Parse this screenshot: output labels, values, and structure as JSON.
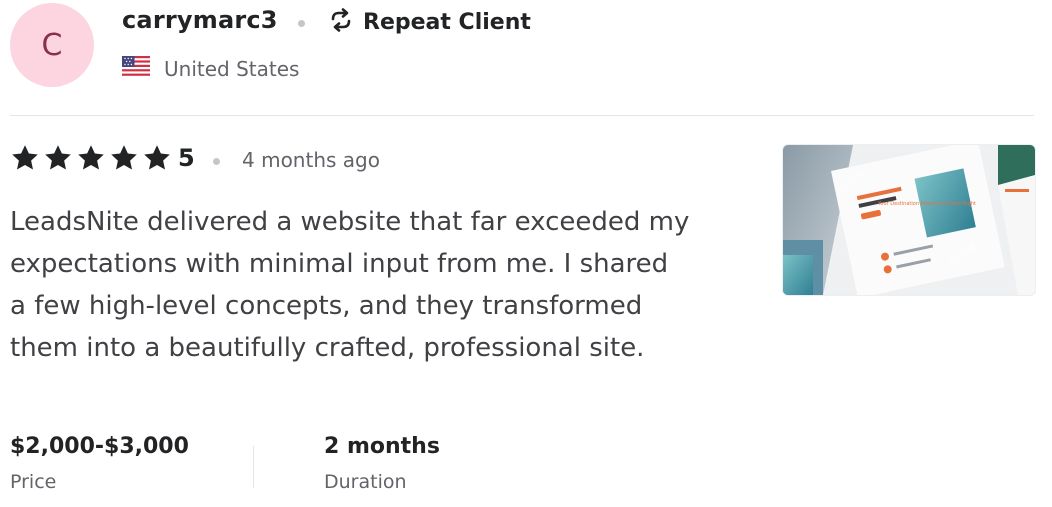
{
  "reviewer": {
    "avatar_initial": "C",
    "username": "carrymarc3",
    "badge": "Repeat Client",
    "badge_icon": "repeat-icon",
    "country": "United States",
    "flag_icon": "us-flag-icon"
  },
  "review": {
    "rating": "5",
    "stars": 5,
    "time_ago": "4 months ago",
    "text": "LeadsNite delivered a website that far exceeded my expectations with minimal input from me. I shared a few high-level concepts, and they transformed them into a beautifully crafted, professional site.",
    "thumbnail_brand": "fiverr.",
    "thumbnail_headline": "Your Destination Adventure Done Right"
  },
  "meta": {
    "price_value": "$2,000-$3,000",
    "price_label": "Price",
    "duration_value": "2 months",
    "duration_label": "Duration"
  },
  "colors": {
    "avatar_bg": "#fcd5e1",
    "text_dark": "#222325",
    "text_muted": "#62646a",
    "accent_orange": "#e8703a"
  }
}
